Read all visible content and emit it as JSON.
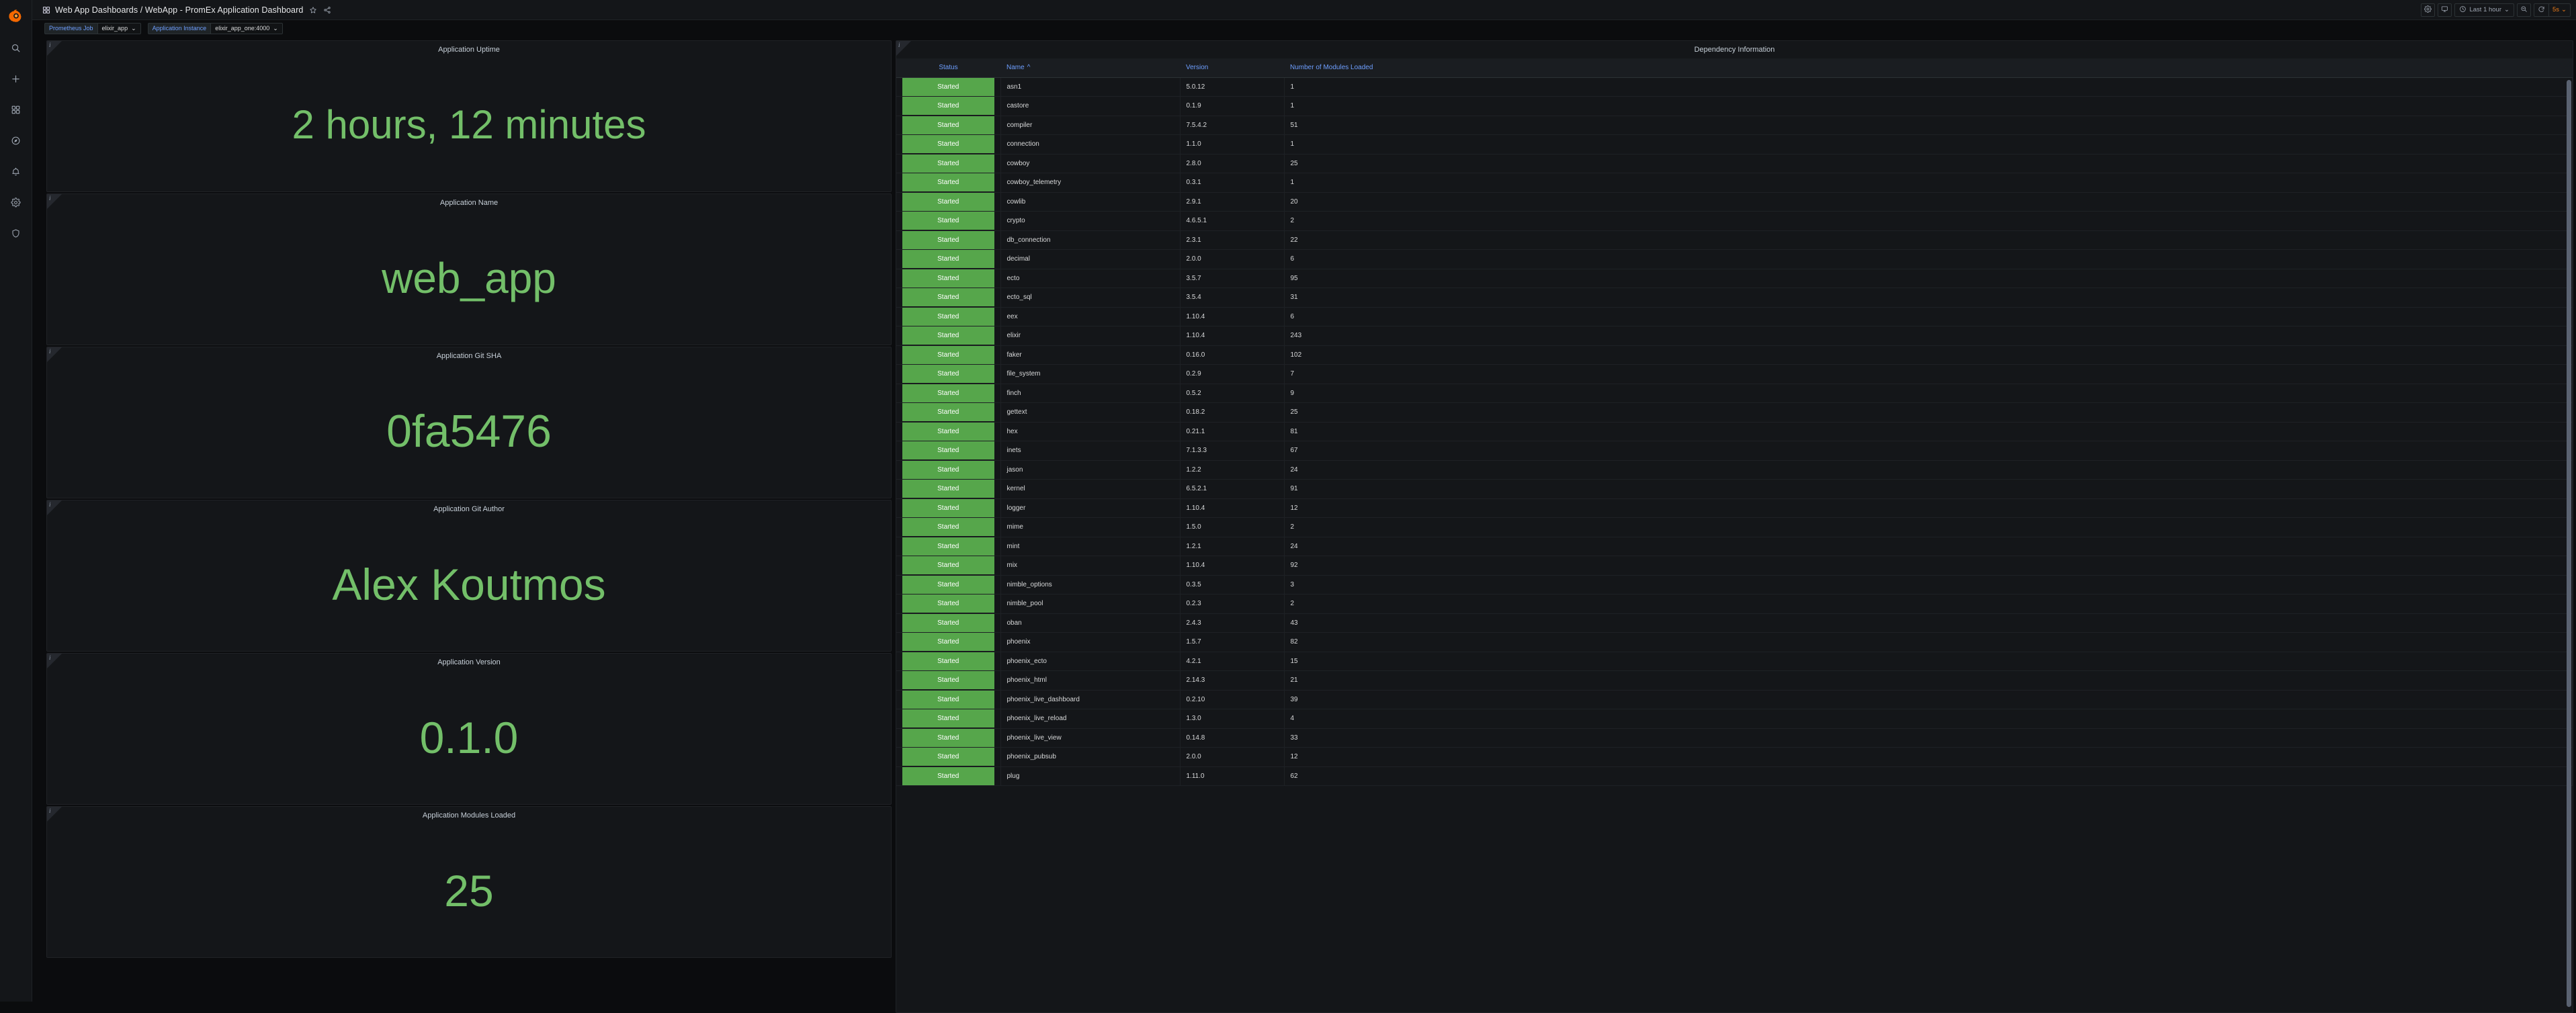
{
  "app": {
    "nav": {
      "items": [
        {
          "name": "search",
          "icon": "search-icon"
        },
        {
          "name": "create",
          "icon": "plus-icon"
        },
        {
          "name": "dashboards",
          "icon": "dashboards-grid-icon"
        },
        {
          "name": "explore",
          "icon": "compass-icon"
        },
        {
          "name": "alerting",
          "icon": "bell-icon"
        },
        {
          "name": "configuration",
          "icon": "gear-icon"
        },
        {
          "name": "server-admin",
          "icon": "shield-icon"
        }
      ]
    },
    "header": {
      "breadcrumb": "Web App Dashboards / WebApp - PromEx Application Dashboard",
      "star_label": "☆",
      "share_label": "share",
      "settings_label": "settings",
      "tv_label": "tv-mode",
      "time_range": "Last 1 hour",
      "zoom_out_label": "zoom-out",
      "refresh_label": "refresh",
      "refresh_interval": "5s",
      "chevron": "⌄"
    },
    "variables": [
      {
        "label": "Prometheus Job",
        "value": "elixir_app",
        "chevron": "⌄"
      },
      {
        "label": "Application Instance",
        "value": "elixir_app_one:4000",
        "chevron": "⌄"
      }
    ],
    "info_glyph": "i"
  },
  "stat_panels": [
    {
      "title": "Application Uptime",
      "value": "2 hours, 12 minutes",
      "font_size": "60px",
      "color": "#73bf69"
    },
    {
      "title": "Application Name",
      "value": "web_app",
      "font_size": "64px",
      "color": "#73bf69"
    },
    {
      "title": "Application Git SHA",
      "value": "0fa5476",
      "font_size": "68px",
      "color": "#73bf69"
    },
    {
      "title": "Application Git Author",
      "value": "Alex Koutmos",
      "font_size": "66px",
      "color": "#73bf69"
    },
    {
      "title": "Application Version",
      "value": "0.1.0",
      "font_size": "66px",
      "color": "#73bf69"
    },
    {
      "title": "Application Modules Loaded",
      "value": "25",
      "font_size": "66px",
      "color": "#73bf69"
    }
  ],
  "table_panel": {
    "title": "Dependency Information",
    "sort_indicator": "^",
    "columns": [
      "Status",
      "Name",
      "Version",
      "Number of Modules Loaded"
    ],
    "rows": [
      [
        "Started",
        "asn1",
        "5.0.12",
        "1"
      ],
      [
        "Started",
        "castore",
        "0.1.9",
        "1"
      ],
      [
        "Started",
        "compiler",
        "7.5.4.2",
        "51"
      ],
      [
        "Started",
        "connection",
        "1.1.0",
        "1"
      ],
      [
        "Started",
        "cowboy",
        "2.8.0",
        "25"
      ],
      [
        "Started",
        "cowboy_telemetry",
        "0.3.1",
        "1"
      ],
      [
        "Started",
        "cowlib",
        "2.9.1",
        "20"
      ],
      [
        "Started",
        "crypto",
        "4.6.5.1",
        "2"
      ],
      [
        "Started",
        "db_connection",
        "2.3.1",
        "22"
      ],
      [
        "Started",
        "decimal",
        "2.0.0",
        "6"
      ],
      [
        "Started",
        "ecto",
        "3.5.7",
        "95"
      ],
      [
        "Started",
        "ecto_sql",
        "3.5.4",
        "31"
      ],
      [
        "Started",
        "eex",
        "1.10.4",
        "6"
      ],
      [
        "Started",
        "elixir",
        "1.10.4",
        "243"
      ],
      [
        "Started",
        "faker",
        "0.16.0",
        "102"
      ],
      [
        "Started",
        "file_system",
        "0.2.9",
        "7"
      ],
      [
        "Started",
        "finch",
        "0.5.2",
        "9"
      ],
      [
        "Started",
        "gettext",
        "0.18.2",
        "25"
      ],
      [
        "Started",
        "hex",
        "0.21.1",
        "81"
      ],
      [
        "Started",
        "inets",
        "7.1.3.3",
        "67"
      ],
      [
        "Started",
        "jason",
        "1.2.2",
        "24"
      ],
      [
        "Started",
        "kernel",
        "6.5.2.1",
        "91"
      ],
      [
        "Started",
        "logger",
        "1.10.4",
        "12"
      ],
      [
        "Started",
        "mime",
        "1.5.0",
        "2"
      ],
      [
        "Started",
        "mint",
        "1.2.1",
        "24"
      ],
      [
        "Started",
        "mix",
        "1.10.4",
        "92"
      ],
      [
        "Started",
        "nimble_options",
        "0.3.5",
        "3"
      ],
      [
        "Started",
        "nimble_pool",
        "0.2.3",
        "2"
      ],
      [
        "Started",
        "oban",
        "2.4.3",
        "43"
      ],
      [
        "Started",
        "phoenix",
        "1.5.7",
        "82"
      ],
      [
        "Started",
        "phoenix_ecto",
        "4.2.1",
        "15"
      ],
      [
        "Started",
        "phoenix_html",
        "2.14.3",
        "21"
      ],
      [
        "Started",
        "phoenix_live_dashboard",
        "0.2.10",
        "39"
      ],
      [
        "Started",
        "phoenix_live_reload",
        "1.3.0",
        "4"
      ],
      [
        "Started",
        "phoenix_live_view",
        "0.14.8",
        "33"
      ],
      [
        "Started",
        "phoenix_pubsub",
        "2.0.0",
        "12"
      ],
      [
        "Started",
        "plug",
        "1.11.0",
        "62"
      ]
    ],
    "status_color": "#56a64b",
    "header_color": "#6e9fff"
  }
}
